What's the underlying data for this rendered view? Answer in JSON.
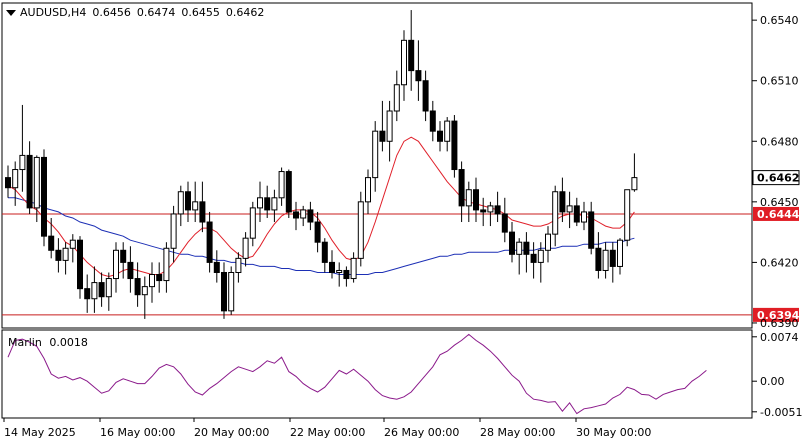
{
  "header": {
    "symbol": "AUDUSD,H4",
    "open": "0.6456",
    "high": "0.6474",
    "low": "0.6455",
    "close": "0.6462"
  },
  "colors": {
    "bull_body": "#ffffff",
    "bear_body": "#000000",
    "candle_outline": "#000000",
    "red_ma": "#e0202a",
    "blue_ma": "#1c2fb5",
    "level_line": "#c81e1e",
    "marlin_line": "#8b1a8b",
    "label_bg_red": "#e01e25",
    "label_text_red": "#ffffff",
    "label_bg_white": "#ffffff",
    "label_text_black": "#000000"
  },
  "indicator": {
    "name": "Marlin",
    "value_label": "0.0018",
    "ticks": [
      "0.0074",
      "0.00",
      "-0.0051"
    ]
  },
  "chart_data": [
    {
      "type": "candlestick",
      "title": "AUDUSD,H4",
      "x_ticks": [
        "14 May 2025",
        "16 May 00:00",
        "20 May 00:00",
        "22 May 00:00",
        "26 May 00:00",
        "28 May 00:00",
        "30 May 00:00"
      ],
      "y_ticks": [
        "0.6540",
        "0.6510",
        "0.6480",
        "0.6450",
        "0.6420",
        "0.6390"
      ],
      "ylim": [
        0.6388,
        0.6548
      ],
      "current_price_label": "0.6462",
      "levels": [
        {
          "value": 0.6444,
          "label": "0.6444"
        },
        {
          "value": 0.6394,
          "label": "0.6394"
        }
      ],
      "candles": [
        [
          0.6462,
          0.6468,
          0.6452,
          0.6457
        ],
        [
          0.6457,
          0.647,
          0.6448,
          0.6466
        ],
        [
          0.6466,
          0.6498,
          0.6455,
          0.6473
        ],
        [
          0.6473,
          0.648,
          0.6444,
          0.6447
        ],
        [
          0.6447,
          0.6473,
          0.644,
          0.6472
        ],
        [
          0.6472,
          0.6476,
          0.6428,
          0.6433
        ],
        [
          0.6433,
          0.6442,
          0.6422,
          0.6426
        ],
        [
          0.6426,
          0.6432,
          0.6415,
          0.6421
        ],
        [
          0.6421,
          0.643,
          0.6414,
          0.6427
        ],
        [
          0.6427,
          0.6434,
          0.642,
          0.6431
        ],
        [
          0.6431,
          0.6433,
          0.6402,
          0.6407
        ],
        [
          0.6407,
          0.6414,
          0.6395,
          0.6402
        ],
        [
          0.6402,
          0.6418,
          0.6395,
          0.641
        ],
        [
          0.641,
          0.6415,
          0.6398,
          0.6403
        ],
        [
          0.6403,
          0.6415,
          0.6396,
          0.6412
        ],
        [
          0.6412,
          0.643,
          0.6405,
          0.6426
        ],
        [
          0.6426,
          0.643,
          0.6412,
          0.642
        ],
        [
          0.642,
          0.6428,
          0.6405,
          0.6412
        ],
        [
          0.6412,
          0.642,
          0.6398,
          0.6404
        ],
        [
          0.6404,
          0.6413,
          0.6392,
          0.6408
        ],
        [
          0.6408,
          0.642,
          0.64,
          0.6414
        ],
        [
          0.6414,
          0.642,
          0.6405,
          0.6411
        ],
        [
          0.6411,
          0.643,
          0.6405,
          0.6427
        ],
        [
          0.6427,
          0.6448,
          0.642,
          0.6444
        ],
        [
          0.6444,
          0.6458,
          0.6438,
          0.6455
        ],
        [
          0.6455,
          0.646,
          0.644,
          0.6446
        ],
        [
          0.6446,
          0.646,
          0.644,
          0.645
        ],
        [
          0.645,
          0.646,
          0.6435,
          0.644
        ],
        [
          0.644,
          0.6445,
          0.6415,
          0.642
        ],
        [
          0.642,
          0.6426,
          0.641,
          0.6415
        ],
        [
          0.6415,
          0.642,
          0.6392,
          0.6396
        ],
        [
          0.6396,
          0.6418,
          0.6394,
          0.6415
        ],
        [
          0.6415,
          0.6425,
          0.641,
          0.6422
        ],
        [
          0.6422,
          0.6435,
          0.6418,
          0.6432
        ],
        [
          0.6432,
          0.645,
          0.6428,
          0.6447
        ],
        [
          0.6447,
          0.646,
          0.644,
          0.6452
        ],
        [
          0.6452,
          0.6458,
          0.6442,
          0.6446
        ],
        [
          0.6446,
          0.6456,
          0.644,
          0.6452
        ],
        [
          0.6452,
          0.6467,
          0.6448,
          0.6465
        ],
        [
          0.6465,
          0.6466,
          0.6442,
          0.6445
        ],
        [
          0.6445,
          0.645,
          0.6436,
          0.6442
        ],
        [
          0.6442,
          0.6448,
          0.6438,
          0.6446
        ],
        [
          0.6446,
          0.645,
          0.6436,
          0.644
        ],
        [
          0.644,
          0.6445,
          0.6425,
          0.643
        ],
        [
          0.643,
          0.6432,
          0.6415,
          0.642
        ],
        [
          0.642,
          0.6426,
          0.6412,
          0.6415
        ],
        [
          0.6415,
          0.642,
          0.6408,
          0.6416
        ],
        [
          0.6416,
          0.6418,
          0.6408,
          0.6412
        ],
        [
          0.6412,
          0.6425,
          0.641,
          0.6422
        ],
        [
          0.6422,
          0.6455,
          0.6418,
          0.645
        ],
        [
          0.645,
          0.6466,
          0.6444,
          0.6462
        ],
        [
          0.6462,
          0.649,
          0.6455,
          0.6485
        ],
        [
          0.6485,
          0.65,
          0.6475,
          0.648
        ],
        [
          0.648,
          0.65,
          0.647,
          0.6495
        ],
        [
          0.6495,
          0.6515,
          0.649,
          0.6508
        ],
        [
          0.6508,
          0.6535,
          0.65,
          0.653
        ],
        [
          0.653,
          0.6545,
          0.6505,
          0.6515
        ],
        [
          0.6515,
          0.653,
          0.65,
          0.651
        ],
        [
          0.651,
          0.6515,
          0.649,
          0.6495
        ],
        [
          0.6495,
          0.65,
          0.648,
          0.6485
        ],
        [
          0.6485,
          0.649,
          0.6475,
          0.648
        ],
        [
          0.648,
          0.6492,
          0.6475,
          0.649
        ],
        [
          0.649,
          0.6493,
          0.6462,
          0.6466
        ],
        [
          0.6466,
          0.647,
          0.644,
          0.6448
        ],
        [
          0.6448,
          0.646,
          0.644,
          0.6456
        ],
        [
          0.6456,
          0.6462,
          0.644,
          0.6446
        ],
        [
          0.6446,
          0.6452,
          0.6438,
          0.6445
        ],
        [
          0.6445,
          0.645,
          0.6438,
          0.6448
        ],
        [
          0.6448,
          0.6455,
          0.644,
          0.6444
        ],
        [
          0.6444,
          0.6452,
          0.643,
          0.6435
        ],
        [
          0.6435,
          0.644,
          0.642,
          0.6424
        ],
        [
          0.6424,
          0.6432,
          0.6414,
          0.643
        ],
        [
          0.643,
          0.6435,
          0.6415,
          0.6424
        ],
        [
          0.6424,
          0.643,
          0.6412,
          0.642
        ],
        [
          0.642,
          0.643,
          0.641,
          0.6426
        ],
        [
          0.6426,
          0.6438,
          0.642,
          0.6434
        ],
        [
          0.6434,
          0.6458,
          0.6428,
          0.6455
        ],
        [
          0.6455,
          0.6462,
          0.644,
          0.6445
        ],
        [
          0.6445,
          0.6455,
          0.6437,
          0.6448
        ],
        [
          0.6448,
          0.6452,
          0.6438,
          0.644
        ],
        [
          0.644,
          0.645,
          0.6436,
          0.6445
        ],
        [
          0.6445,
          0.645,
          0.6424,
          0.6427
        ],
        [
          0.6427,
          0.6435,
          0.6412,
          0.6416
        ],
        [
          0.6416,
          0.643,
          0.6412,
          0.6426
        ],
        [
          0.6426,
          0.643,
          0.641,
          0.6418
        ],
        [
          0.6418,
          0.6432,
          0.6414,
          0.6431
        ],
        [
          0.6431,
          0.6456,
          0.6428,
          0.6456
        ],
        [
          0.6456,
          0.6474,
          0.6455,
          0.6462
        ]
      ],
      "red_ma": [
        0.6458,
        0.6456,
        0.6452,
        0.6448,
        0.6446,
        0.6442,
        0.6439,
        0.6435,
        0.643,
        0.6428,
        0.6424,
        0.642,
        0.6417,
        0.6414,
        0.6413,
        0.6414,
        0.6416,
        0.6417,
        0.6416,
        0.6415,
        0.6414,
        0.6414,
        0.6416,
        0.642,
        0.6425,
        0.643,
        0.6434,
        0.6437,
        0.6437,
        0.6435,
        0.6431,
        0.6427,
        0.6424,
        0.6422,
        0.6423,
        0.6428,
        0.6434,
        0.6439,
        0.6443,
        0.6445,
        0.6446,
        0.6446,
        0.6445,
        0.6442,
        0.6437,
        0.6431,
        0.6426,
        0.6422,
        0.6421,
        0.6423,
        0.643,
        0.644,
        0.6451,
        0.6462,
        0.6473,
        0.648,
        0.6482,
        0.648,
        0.6475,
        0.647,
        0.6465,
        0.646,
        0.6456,
        0.6452,
        0.645,
        0.6449,
        0.6448,
        0.6447,
        0.6446,
        0.6444,
        0.6441,
        0.644,
        0.6439,
        0.6438,
        0.6438,
        0.6439,
        0.6441,
        0.6443,
        0.6444,
        0.6444,
        0.6443,
        0.6442,
        0.644,
        0.6438,
        0.6437,
        0.6437,
        0.644,
        0.6445
      ],
      "blue_ma": [
        0.6452,
        0.6452,
        0.6451,
        0.645,
        0.6449,
        0.6447,
        0.6446,
        0.6445,
        0.6443,
        0.6442,
        0.644,
        0.6439,
        0.6438,
        0.6436,
        0.6435,
        0.6434,
        0.6433,
        0.6431,
        0.643,
        0.6429,
        0.6428,
        0.6427,
        0.6426,
        0.6425,
        0.6424,
        0.6424,
        0.6423,
        0.6423,
        0.6422,
        0.6421,
        0.6421,
        0.642,
        0.642,
        0.6419,
        0.6419,
        0.6418,
        0.6418,
        0.6418,
        0.6417,
        0.6417,
        0.6416,
        0.6416,
        0.6416,
        0.6415,
        0.6415,
        0.6415,
        0.6414,
        0.6414,
        0.6414,
        0.6414,
        0.6414,
        0.6415,
        0.6415,
        0.6416,
        0.6417,
        0.6418,
        0.6419,
        0.642,
        0.6421,
        0.6422,
        0.6423,
        0.6423,
        0.6424,
        0.6424,
        0.6425,
        0.6425,
        0.6425,
        0.6425,
        0.6425,
        0.6426,
        0.6426,
        0.6426,
        0.6426,
        0.6426,
        0.6427,
        0.6427,
        0.6427,
        0.6428,
        0.6428,
        0.6428,
        0.6429,
        0.6429,
        0.6429,
        0.643,
        0.643,
        0.643,
        0.6431,
        0.6432
      ],
      "marlin": [
        0.004,
        0.0068,
        0.007,
        0.0065,
        0.0058,
        0.0038,
        0.0012,
        0.0005,
        0.0008,
        0.0002,
        0.0006,
        0.0,
        -0.001,
        -0.002,
        -0.0016,
        -0.0002,
        0.0004,
        0.0,
        -0.0004,
        -0.0004,
        0.0008,
        0.0022,
        0.0028,
        0.0024,
        0.0012,
        -0.0005,
        -0.0018,
        -0.0023,
        -0.0012,
        -0.0004,
        0.0006,
        0.0016,
        0.0024,
        0.002,
        0.0016,
        0.0024,
        0.0034,
        0.003,
        0.004,
        0.0016,
        0.0008,
        -0.0004,
        -0.0012,
        -0.0018,
        -0.001,
        0.0004,
        0.0018,
        0.0012,
        0.002,
        0.001,
        0.0,
        -0.0014,
        -0.0024,
        -0.0028,
        -0.003,
        -0.0026,
        -0.0018,
        -0.0004,
        0.001,
        0.0024,
        0.0044,
        0.005,
        0.006,
        0.0068,
        0.0078,
        0.0068,
        0.006,
        0.005,
        0.0038,
        0.0024,
        0.001,
        0.0,
        -0.002,
        -0.003,
        -0.0032,
        -0.0035,
        -0.0034,
        -0.005,
        -0.0036,
        -0.0054,
        -0.0046,
        -0.0044,
        -0.0041,
        -0.0038,
        -0.0028,
        -0.0022,
        -0.001,
        -0.0014,
        -0.0022,
        -0.0023,
        -0.003,
        -0.0022,
        -0.0018,
        -0.0014,
        -0.0012,
        0.0,
        0.0008,
        0.0018
      ]
    }
  ]
}
